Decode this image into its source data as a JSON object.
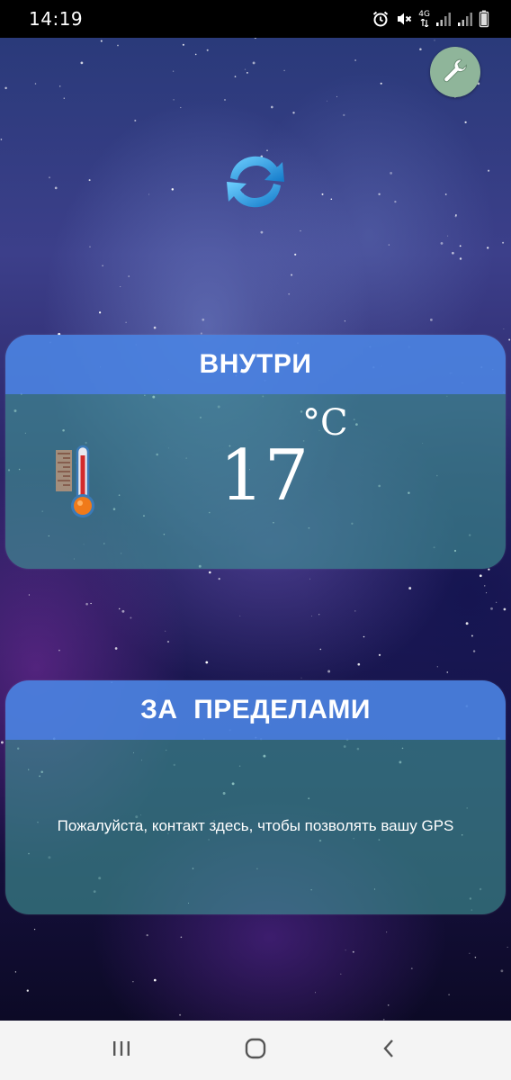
{
  "status_bar": {
    "time": "14:19",
    "network_label": "4G",
    "icons": [
      "alarm-icon",
      "mute-icon",
      "network-4g-icon",
      "signal-icon",
      "signal-icon-2",
      "battery-icon"
    ]
  },
  "top_controls": {
    "settings_icon": "wrench-icon",
    "refresh_icon": "refresh-icon"
  },
  "inside_card": {
    "title": "ВНУТРИ",
    "temperature": "17",
    "unit": "°C",
    "icon": "thermometer-icon"
  },
  "outside_card": {
    "title": "ЗА  ПРЕДЕЛАМИ",
    "message": "Пожалуйста, контакт здесь, чтобы позволять вашу GPS"
  },
  "nav_bar": {
    "items": [
      "recent-apps-icon",
      "home-icon",
      "back-icon"
    ]
  },
  "colors": {
    "header_blue": "#4b82e1",
    "body_teal": "#409696",
    "settings_green": "#8fb59a",
    "refresh_blue": "#2fa3e6"
  }
}
